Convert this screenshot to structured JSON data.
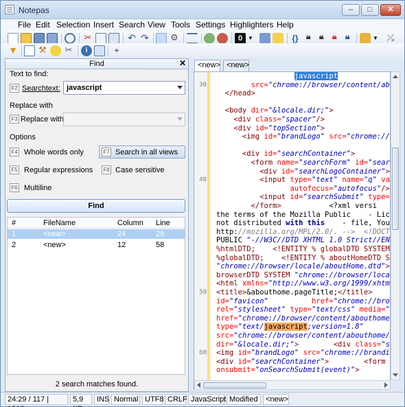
{
  "window": {
    "title": "Notepas",
    "controls": {
      "minimize": "–",
      "maximize": "□",
      "close": "✕"
    }
  },
  "menu": [
    "File",
    "Edit",
    "Selection",
    "Insert",
    "Search",
    "View",
    "Tools",
    "Settings",
    "Highlighters",
    "Help"
  ],
  "toolbar": {
    "row1_icons": [
      "new-file-icon",
      "open-file-icon",
      "save-icon",
      "save-all-icon",
      "reload-icon",
      "cut-icon",
      "copy-icon",
      "paste-icon",
      "undo-icon",
      "redo-icon",
      "toggle-panel-icon",
      "settings-icon",
      "align-icon",
      "find-next-icon",
      "find-prev-icon",
      "dropdown-icon",
      "edit-icon",
      "curly-braces-icon",
      "quote-icon",
      "comment-icon",
      "uncomment-icon",
      "toggle-comment-icon",
      "highlighter-icon",
      "split-icon"
    ],
    "row2_icons": [
      "filter-icon",
      "window-icon",
      "wand-icon",
      "bulb-icon",
      "tools-icon",
      "info-icon",
      "copy-window-icon",
      "binoculars-icon"
    ],
    "zero_label": "0"
  },
  "find_panel": {
    "title": "Find",
    "close": "✕",
    "text_to_find_label": "Text to find:",
    "searchtext_key": "F2",
    "searchtext_label": "Searchtext:",
    "searchtext_value": "javascript",
    "replace_with_label": "Replace with",
    "replace_key": "F3",
    "replace_label": "Replace with:",
    "replace_value": "",
    "options_label": "Options",
    "options": [
      {
        "key": "F4",
        "label": "Whole words only"
      },
      {
        "key": "F7",
        "label": "Search in all views",
        "active": true
      },
      {
        "key": "F5",
        "label": "Regular expressions"
      },
      {
        "key": "F8",
        "label": "Case sensitive"
      },
      {
        "key": "F6",
        "label": "Multiline"
      }
    ],
    "find_button": "Find",
    "results": {
      "columns": [
        "#",
        "FileName",
        "Column",
        "Line"
      ],
      "rows": [
        {
          "n": "1",
          "file": "<new>",
          "col": "24",
          "line": "29",
          "selected": true
        },
        {
          "n": "2",
          "file": "<new>",
          "col": "12",
          "line": "58",
          "selected": false
        }
      ]
    },
    "summary": "2 search matches found."
  },
  "tabs": [
    "<new>",
    "<new>"
  ],
  "editor": {
    "gutter_numbers": [
      {
        "num": "30",
        "line": 1
      },
      {
        "num": "40",
        "line": 12
      },
      {
        "num": "50",
        "line": 25
      },
      {
        "num": "60",
        "line": 32
      }
    ],
    "lines": [
      [
        {
          "t": "",
          "c": ""
        },
        {
          "t": "javascript",
          "c": "hlsel",
          "pad": "                  "
        }
      ],
      [
        {
          "t": "        src=",
          "c": "a"
        },
        {
          "t": "\"chrome://browser/content/abo",
          "c": "s"
        }
      ],
      [
        {
          "t": "  </head>",
          "c": "t"
        }
      ],
      [
        {
          "t": "",
          "c": ""
        }
      ],
      [
        {
          "t": "  <body ",
          "c": "t"
        },
        {
          "t": "dir=",
          "c": "a"
        },
        {
          "t": "\"&locale.dir;\"",
          "c": "s"
        },
        {
          "t": ">",
          "c": "t"
        }
      ],
      [
        {
          "t": "    <div ",
          "c": "t"
        },
        {
          "t": "class=",
          "c": "a"
        },
        {
          "t": "\"spacer\"",
          "c": "s"
        },
        {
          "t": "/>",
          "c": "t"
        }
      ],
      [
        {
          "t": "    <div ",
          "c": "t"
        },
        {
          "t": "id=",
          "c": "a"
        },
        {
          "t": "\"topSection\"",
          "c": "s"
        },
        {
          "t": ">",
          "c": "t"
        }
      ],
      [
        {
          "t": "      <img ",
          "c": "t"
        },
        {
          "t": "id=",
          "c": "a"
        },
        {
          "t": "\"brandLogo\" ",
          "c": "s"
        },
        {
          "t": "src=",
          "c": "a"
        },
        {
          "t": "\"chrome://bra",
          "c": "s"
        }
      ],
      [
        {
          "t": "",
          "c": ""
        }
      ],
      [
        {
          "t": "      <div ",
          "c": "t"
        },
        {
          "t": "id=",
          "c": "a"
        },
        {
          "t": "\"searchContainer\"",
          "c": "s"
        },
        {
          "t": ">",
          "c": "t"
        }
      ],
      [
        {
          "t": "        <form ",
          "c": "t"
        },
        {
          "t": "name=",
          "c": "a"
        },
        {
          "t": "\"searchForm\" ",
          "c": "s"
        },
        {
          "t": "id=",
          "c": "a"
        },
        {
          "t": "\"search",
          "c": "s"
        }
      ],
      [
        {
          "t": "          <div ",
          "c": "t"
        },
        {
          "t": "id=",
          "c": "a"
        },
        {
          "t": "\"searchLogoContainer\"",
          "c": "s"
        },
        {
          "t": "><i",
          "c": "t"
        }
      ],
      [
        {
          "t": "          <input ",
          "c": "t"
        },
        {
          "t": "type=",
          "c": "a"
        },
        {
          "t": "\"text\" ",
          "c": "s"
        },
        {
          "t": "name=",
          "c": "a"
        },
        {
          "t": "\"q\" ",
          "c": "s"
        },
        {
          "t": "valu",
          "c": "a"
        }
      ],
      [
        {
          "t": "                 autofocus=",
          "c": "a"
        },
        {
          "t": "\"autofocus\"",
          "c": "s"
        },
        {
          "t": "/>",
          "c": "t"
        }
      ],
      [
        {
          "t": "          <input ",
          "c": "t"
        },
        {
          "t": "id=",
          "c": "a"
        },
        {
          "t": "\"searchSubmit\" ",
          "c": "s"
        },
        {
          "t": "type=",
          "c": "a"
        },
        {
          "t": "\"s",
          "c": "s"
        }
      ],
      [
        {
          "t": "        </form>",
          "c": "t"
        },
        {
          "t": "           <?xml versi",
          "c": ""
        }
      ],
      [
        {
          "t": "the terms of the Mozilla Public    - Licen",
          "c": ""
        }
      ],
      [
        {
          "t": "not distributed ",
          "c": ""
        },
        {
          "t": "with this",
          "c": "k"
        },
        {
          "t": "    - file, You ca",
          "c": ""
        }
      ],
      [
        {
          "t": "http:",
          "c": ""
        },
        {
          "t": "//mozilla.org/MPL/2.0/. -->  <!DOCTYP",
          "c": "c"
        }
      ],
      [
        {
          "t": "PUBLIC ",
          "c": ""
        },
        {
          "t": "\"-//W3C//DTD XHTML 1.0 Strict//EN\"",
          "c": "s"
        },
        {
          "t": " ",
          "c": ""
        }
      ],
      [
        {
          "t": "%htmlDTD;    <!ENTITY % globalDTD SYSTEM ",
          "c": "t"
        },
        {
          "t": "\"c",
          "c": "s"
        }
      ],
      [
        {
          "t": "%globalDTD;    <!ENTITY % aboutHomeDTD SYST",
          "c": "t"
        }
      ],
      [
        {
          "t": "\"chrome://browser/locale/aboutHome.dtd\"",
          "c": "s"
        },
        {
          "t": ">",
          "c": "t"
        }
      ],
      [
        {
          "t": "browserDTD SYSTEM ",
          "c": "t"
        },
        {
          "t": "\"chrome://browser/locale",
          "c": "s"
        }
      ],
      [
        {
          "t": "<html ",
          "c": "t"
        },
        {
          "t": "xmlns=",
          "c": "a"
        },
        {
          "t": "\"http://www.w3.org/1999/xhtml\"",
          "c": "s"
        }
      ],
      [
        {
          "t": "<title>",
          "c": "t"
        },
        {
          "t": "&abouthome.pageTitle;",
          "c": ""
        },
        {
          "t": "</title>",
          "c": "t"
        }
      ],
      [
        {
          "t": "id=",
          "c": "a"
        },
        {
          "t": "\"favicon\"",
          "c": "s"
        },
        {
          "t": "          href=",
          "c": "a"
        },
        {
          "t": "\"chrome://bro",
          "c": "s"
        }
      ],
      [
        {
          "t": "rel=",
          "c": "a"
        },
        {
          "t": "\"stylesheet\" ",
          "c": "s"
        },
        {
          "t": "type=",
          "c": "a"
        },
        {
          "t": "\"text/css\" ",
          "c": "s"
        },
        {
          "t": "media=",
          "c": "a"
        },
        {
          "t": "\"al",
          "c": "s"
        }
      ],
      [
        {
          "t": "href=",
          "c": "a"
        },
        {
          "t": "\"chrome://browser/content/abouthome/c",
          "c": "s"
        }
      ],
      [
        {
          "t": "type=",
          "c": "a"
        },
        {
          "t": "\"text/",
          "c": "s"
        },
        {
          "t": "javascript",
          "c": "hl"
        },
        {
          "t": ";version=1.8\"",
          "c": "s"
        }
      ],
      [
        {
          "t": "src=",
          "c": "a"
        },
        {
          "t": "\"chrome://browser/content/abouthome/ab",
          "c": "s"
        }
      ],
      [
        {
          "t": "dir=",
          "c": "a"
        },
        {
          "t": "\"&locale.dir;\"",
          "c": "s"
        },
        {
          "t": ">",
          "c": "t"
        },
        {
          "t": "        <div ",
          "c": "t"
        },
        {
          "t": "class=",
          "c": "a"
        },
        {
          "t": "\"spacer",
          "c": "s"
        }
      ],
      [
        {
          "t": "<img ",
          "c": "t"
        },
        {
          "t": "id=",
          "c": "a"
        },
        {
          "t": "\"brandLogo\" ",
          "c": "s"
        },
        {
          "t": "src=",
          "c": "a"
        },
        {
          "t": "\"chrome://branding",
          "c": "s"
        }
      ],
      [
        {
          "t": "<div ",
          "c": "t"
        },
        {
          "t": "id=",
          "c": "a"
        },
        {
          "t": "\"searchContainer\"",
          "c": "s"
        },
        {
          "t": ">",
          "c": "t"
        },
        {
          "t": "        <form n",
          "c": "t"
        }
      ],
      [
        {
          "t": "onsubmit=",
          "c": "a"
        },
        {
          "t": "\"onSearchSubmit(event)\"",
          "c": "s"
        },
        {
          "t": ">",
          "c": "t"
        }
      ]
    ]
  },
  "status": [
    "24:29 / 117 | 1018",
    "5,9 KB",
    "INS",
    "Normal",
    "UTF8",
    "CRLF",
    "JavaScript",
    "Modified",
    "<new>"
  ],
  "colors": {
    "selection": "#aed0f3",
    "accent": "#2f7fd8",
    "highlight": "#f3a95f",
    "frame": "#6a8bb3"
  }
}
